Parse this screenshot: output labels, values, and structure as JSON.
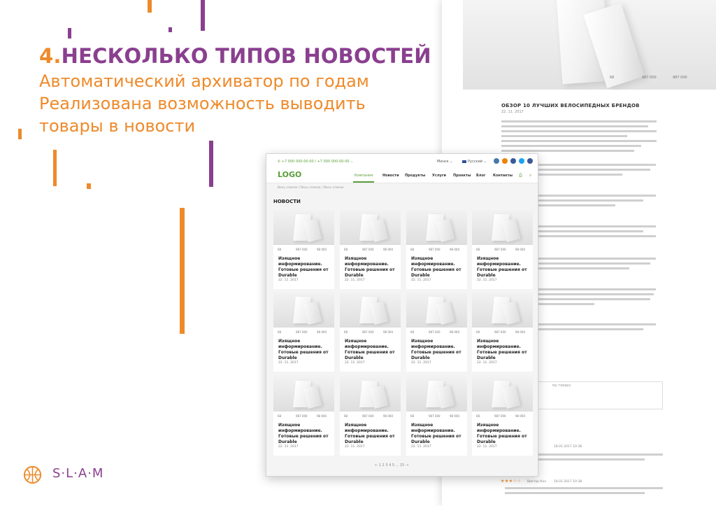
{
  "headline": {
    "number": "4.",
    "title": "НЕСКОЛЬКО ТИПОВ НОВОСТЕЙ"
  },
  "sublines": [
    "Автоматический архиватор по годам",
    "Реализована возможность выводить",
    "товары в новости"
  ],
  "brand": {
    "name": "S·L·A·M",
    "orange": "#ee8a2a",
    "purple": "#8a3f8f",
    "site_green": "#5a9e3a"
  },
  "article": {
    "hero_views": "68",
    "hero_likes": "987 000",
    "hero_shares": "987 000",
    "title": "ОБЗОР 10 ЛУЧШИХ ВЕЛОСИПЕДНЫХ БРЕНДОВ",
    "date": "22. 11. 2017",
    "comment_placeholder": "му товару",
    "review_date_1": "18.01.2017 10:38",
    "review_author": "Виктор Кох",
    "review_date_2": "18.01.2017 10:38"
  },
  "site": {
    "phones": "+7 000 000-00-00  /  +7 000 000-00-00",
    "city": "Минск",
    "lang": "Русский",
    "logo": "LOGO",
    "nav": [
      "Компания",
      "Новости",
      "Продукты",
      "Услуги",
      "Проекты",
      "Блог",
      "Контакты"
    ],
    "breadcrumbs": "Весь список   /   Весь список   /   Весь список",
    "section_title": "НОВОСТИ",
    "pager": "←   1  2  3  4  5  ...  15   →"
  },
  "cards": [
    {
      "views": "68",
      "rating": "987 000",
      "likes": "98 000",
      "title": "Изящное информирование. Готовые решения от Durable",
      "date": "22. 11. 2017"
    },
    {
      "views": "68",
      "rating": "987 000",
      "likes": "98 000",
      "title": "Изящное информирование. Готовые решения от Durable",
      "date": "22. 11. 2017"
    },
    {
      "views": "68",
      "rating": "987 000",
      "likes": "98 000",
      "title": "Изящное информирование. Готовые решения от Durable",
      "date": "22. 11. 2017"
    },
    {
      "views": "68",
      "rating": "987 000",
      "likes": "98 000",
      "title": "Изящное информирование. Готовые решения от Durable",
      "date": "22. 11. 2017"
    },
    {
      "views": "68",
      "rating": "987 000",
      "likes": "98 000",
      "title": "Изящное информирование. Готовые решения от Durable",
      "date": "22. 11. 2017"
    },
    {
      "views": "68",
      "rating": "987 000",
      "likes": "98 000",
      "title": "Изящное информирование. Готовые решения от Durable",
      "date": "22. 11. 2017"
    },
    {
      "views": "68",
      "rating": "987 000",
      "likes": "98 000",
      "title": "Изящное информирование. Готовые решения от Durable",
      "date": "22. 11. 2017"
    },
    {
      "views": "68",
      "rating": "987 000",
      "likes": "98 000",
      "title": "Изящное информирование. Готовые решения от Durable",
      "date": "22. 11. 2017"
    },
    {
      "views": "68",
      "rating": "987 000",
      "likes": "98 000",
      "title": "Изящное информирование. Готовые решения от Durable",
      "date": "22. 11. 2017"
    },
    {
      "views": "68",
      "rating": "987 000",
      "likes": "98 000",
      "title": "Изящное информирование. Готовые решения от Durable",
      "date": "22. 11. 2017"
    },
    {
      "views": "68",
      "rating": "987 000",
      "likes": "98 000",
      "title": "Изящное информирование. Готовые решения от Durable",
      "date": "22. 11. 2017"
    },
    {
      "views": "68",
      "rating": "987 000",
      "likes": "98 000",
      "title": "Изящное информирование. Готовые решения от Durable",
      "date": "22. 11. 2017"
    }
  ]
}
